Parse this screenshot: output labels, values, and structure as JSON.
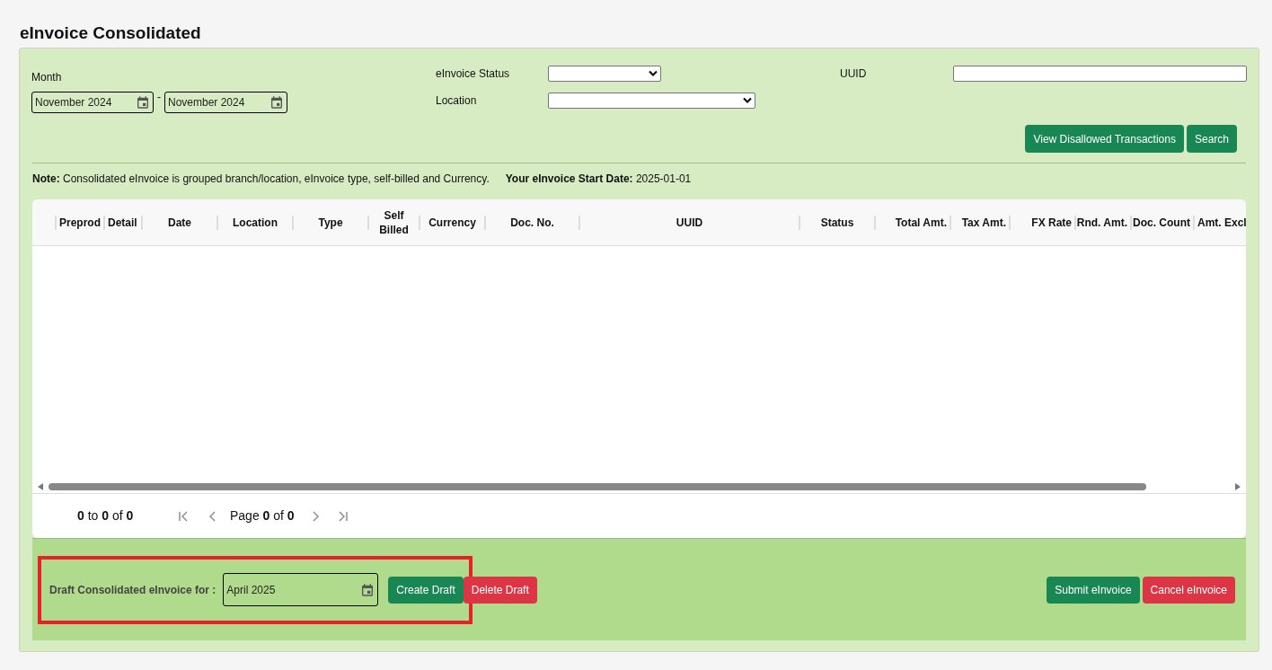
{
  "page_title": "eInvoice Consolidated",
  "filters": {
    "month_label": "Month",
    "month_from": "November 2024",
    "month_separator": "-",
    "month_to": "November 2024",
    "status_label": "eInvoice Status",
    "location_label": "Location",
    "uuid_label": "UUID"
  },
  "actions": [
    {
      "label": "View Disallowed Transactions",
      "kind": "primary"
    },
    {
      "label": "Search",
      "kind": "primary"
    }
  ],
  "note": "**Note:** Consolidated eInvoice is grouped branch/location, eInvoice type, self-billed and Currency.",
  "start_date": "**Your eInvoice Start Date:** 2025-01-01",
  "table": {
    "columns": [
      {
        "label": "Preprod"
      },
      {
        "label": "Detail"
      },
      {
        "label": "Date"
      },
      {
        "label": "Location"
      },
      {
        "label": "Type"
      },
      {
        "label": "Self Billed"
      },
      {
        "label": "Currency"
      },
      {
        "label": "Doc. No."
      },
      {
        "label": "UUID"
      },
      {
        "label": "Status"
      },
      {
        "label": "Total Amt."
      },
      {
        "label": "Tax Amt."
      },
      {
        "label": "FX Rate"
      },
      {
        "label": "Rnd. Amt."
      },
      {
        "label": "Doc. Count"
      },
      {
        "label": "Amt. Excl"
      }
    ]
  },
  "pagination": {
    "range": "**0** to **0** of **0**",
    "page": "Page **0** of **0**"
  },
  "draft": {
    "label": "Draft Consolidated eInvoice for :",
    "month": "April 2025",
    "highlighted": true,
    "buttons": [
      {
        "label": "Create Draft",
        "kind": "primary"
      },
      {
        "label": "Delete Draft",
        "kind": "danger"
      }
    ]
  },
  "submit_buttons": [
    {
      "label": "Submit eInvoice",
      "kind": "primary"
    },
    {
      "label": "Cancel eInvoice",
      "kind": "danger"
    }
  ]
}
